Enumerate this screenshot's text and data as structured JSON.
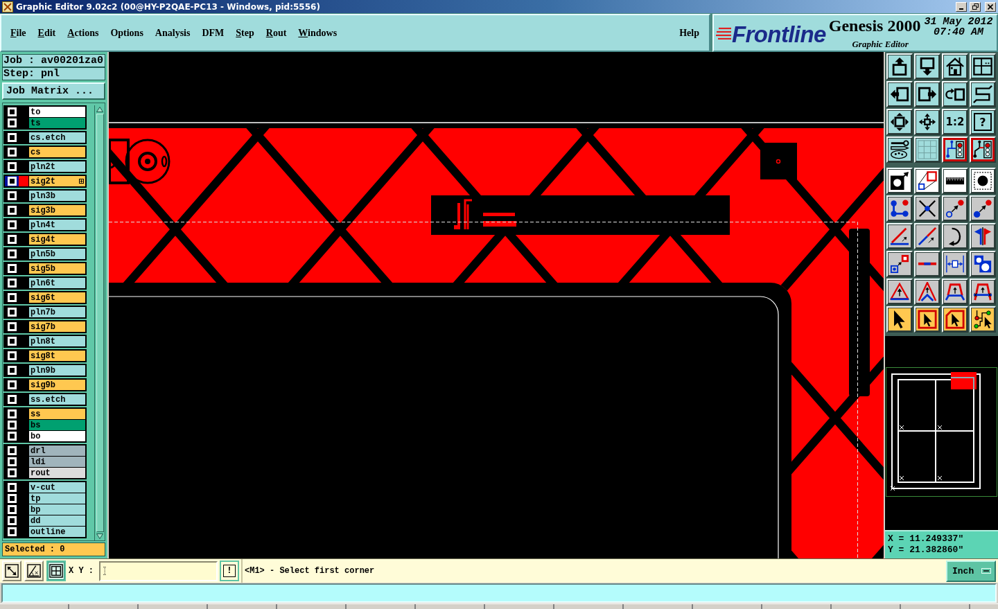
{
  "window": {
    "title": "Graphic Editor 9.02c2 (00@HY-P2QAE-PC13 - Windows, pid:5556)"
  },
  "menu": {
    "items": [
      {
        "label": "File",
        "mnemonic": true
      },
      {
        "label": "Edit",
        "mnemonic": true
      },
      {
        "label": "Actions",
        "mnemonic": true
      },
      {
        "label": "Options",
        "mnemonic": false
      },
      {
        "label": "Analysis",
        "mnemonic": false
      },
      {
        "label": "DFM",
        "mnemonic": false
      },
      {
        "label": "Step",
        "mnemonic": true
      },
      {
        "label": "Rout",
        "mnemonic": true
      },
      {
        "label": "Windows",
        "mnemonic": true
      }
    ],
    "help": {
      "label": "Help",
      "mnemonic": false
    }
  },
  "brand": {
    "logo": "Frontline",
    "product": "Genesis 2000",
    "date": "31 May 2012",
    "time": "07:40 AM",
    "subtitle": "Graphic Editor"
  },
  "job_panel": {
    "job": "Job : av00201za0",
    "step": "Step: pnl",
    "matrix_button": "Job Matrix ...",
    "layer_groups": [
      {
        "layers": [
          {
            "name": "to",
            "kind": "silk",
            "color": "#000000",
            "selected": false
          },
          {
            "name": "ts",
            "kind": "mask",
            "color": "#000000",
            "selected": false
          }
        ]
      },
      {
        "layers": [
          {
            "name": "cs.etch",
            "kind": "document",
            "color": "#000000",
            "selected": false
          }
        ]
      },
      {
        "layers": [
          {
            "name": "cs",
            "kind": "signal",
            "color": "#000000",
            "selected": false
          }
        ]
      },
      {
        "layers": [
          {
            "name": "pln2t",
            "kind": "plane",
            "color": "#000000",
            "selected": false
          }
        ]
      },
      {
        "layers": [
          {
            "name": "sig2t",
            "kind": "signal",
            "color": "#ff0000",
            "selected": true
          }
        ]
      },
      {
        "layers": [
          {
            "name": "pln3b",
            "kind": "plane",
            "color": "#000000",
            "selected": false
          }
        ]
      },
      {
        "layers": [
          {
            "name": "sig3b",
            "kind": "signal",
            "color": "#000000",
            "selected": false
          }
        ]
      },
      {
        "layers": [
          {
            "name": "pln4t",
            "kind": "plane",
            "color": "#000000",
            "selected": false
          }
        ]
      },
      {
        "layers": [
          {
            "name": "sig4t",
            "kind": "signal",
            "color": "#000000",
            "selected": false
          }
        ]
      },
      {
        "layers": [
          {
            "name": "pln5b",
            "kind": "plane",
            "color": "#000000",
            "selected": false
          }
        ]
      },
      {
        "layers": [
          {
            "name": "sig5b",
            "kind": "signal",
            "color": "#000000",
            "selected": false
          }
        ]
      },
      {
        "layers": [
          {
            "name": "pln6t",
            "kind": "plane",
            "color": "#000000",
            "selected": false
          }
        ]
      },
      {
        "layers": [
          {
            "name": "sig6t",
            "kind": "signal",
            "color": "#000000",
            "selected": false
          }
        ]
      },
      {
        "layers": [
          {
            "name": "pln7b",
            "kind": "plane",
            "color": "#000000",
            "selected": false
          }
        ]
      },
      {
        "layers": [
          {
            "name": "sig7b",
            "kind": "signal",
            "color": "#000000",
            "selected": false
          }
        ]
      },
      {
        "layers": [
          {
            "name": "pln8t",
            "kind": "plane",
            "color": "#000000",
            "selected": false
          }
        ]
      },
      {
        "layers": [
          {
            "name": "sig8t",
            "kind": "signal",
            "color": "#000000",
            "selected": false
          }
        ]
      },
      {
        "layers": [
          {
            "name": "pln9b",
            "kind": "plane",
            "color": "#000000",
            "selected": false
          }
        ]
      },
      {
        "layers": [
          {
            "name": "sig9b",
            "kind": "signal",
            "color": "#000000",
            "selected": false
          }
        ]
      },
      {
        "layers": [
          {
            "name": "ss.etch",
            "kind": "document",
            "color": "#000000",
            "selected": false
          }
        ]
      },
      {
        "layers": [
          {
            "name": "ss",
            "kind": "signal",
            "color": "#000000",
            "selected": false
          },
          {
            "name": "bs",
            "kind": "mask",
            "color": "#000000",
            "selected": false
          },
          {
            "name": "bo",
            "kind": "silk",
            "color": "#000000",
            "selected": false
          }
        ]
      },
      {
        "layers": [
          {
            "name": "drl",
            "kind": "drill",
            "color": "#000000",
            "selected": false
          },
          {
            "name": "ldi",
            "kind": "drill",
            "color": "#000000",
            "selected": false
          },
          {
            "name": "rout",
            "kind": "rout",
            "color": "#000000",
            "selected": false
          }
        ]
      },
      {
        "layers": [
          {
            "name": "v-cut",
            "kind": "document",
            "color": "#000000",
            "selected": false
          },
          {
            "name": "tp",
            "kind": "document",
            "color": "#000000",
            "selected": false
          },
          {
            "name": "bp",
            "kind": "document",
            "color": "#000000",
            "selected": false
          },
          {
            "name": "dd",
            "kind": "document",
            "color": "#000000",
            "selected": false
          },
          {
            "name": "outline",
            "kind": "document",
            "color": "#000000",
            "selected": false
          }
        ]
      }
    ],
    "selected_count": "Selected : 0"
  },
  "toolbar": {
    "groups": [
      {
        "rows": [
          {
            "tools": [
              {
                "kind": "pan-up",
                "on": false
              },
              {
                "kind": "pan-down",
                "on": false
              },
              {
                "kind": "home",
                "on": false
              },
              {
                "kind": "window",
                "on": false
              }
            ]
          },
          {
            "tools": [
              {
                "kind": "pan-left",
                "on": false
              },
              {
                "kind": "pan-right",
                "on": false
              },
              {
                "kind": "undo-view",
                "on": false
              },
              {
                "kind": "route",
                "on": false
              }
            ]
          },
          {
            "tools": [
              {
                "kind": "zoom-out",
                "on": false
              },
              {
                "kind": "zoom-in",
                "on": false
              },
              {
                "kind": "text",
                "label": "1:2",
                "on": false
              },
              {
                "kind": "framed-text",
                "label": "?",
                "on": false
              }
            ]
          },
          {
            "tools": [
              {
                "kind": "tools",
                "on": false
              },
              {
                "kind": "grid",
                "on": false
              },
              {
                "kind": "snap-a",
                "on": true
              },
              {
                "kind": "snap-b",
                "on": true
              }
            ]
          }
        ]
      },
      {
        "rows": [
          {
            "tools": [
              {
                "kind": "snap-center",
                "on": false
              },
              {
                "kind": "snap-box",
                "on": false
              },
              {
                "kind": "measure",
                "on": false
              },
              {
                "kind": "snap-pad",
                "on": false
              }
            ]
          },
          {
            "tools": [
              {
                "kind": "connect",
                "on": false
              },
              {
                "kind": "delete",
                "on": false
              },
              {
                "kind": "move-hollow",
                "on": false
              },
              {
                "kind": "move-solid",
                "on": false
              }
            ]
          },
          {
            "tools": [
              {
                "kind": "angle",
                "on": false
              },
              {
                "kind": "line",
                "on": false
              },
              {
                "kind": "rotate",
                "on": false
              },
              {
                "kind": "mirror",
                "on": false
              }
            ]
          },
          {
            "tools": [
              {
                "kind": "move-pad",
                "on": false
              },
              {
                "kind": "cut-line",
                "on": false
              },
              {
                "kind": "dimension",
                "on": false
              },
              {
                "kind": "shapes",
                "on": false
              }
            ]
          },
          {
            "tools": [
              {
                "kind": "triangle",
                "on": false
              },
              {
                "kind": "chevron",
                "on": false
              },
              {
                "kind": "arch",
                "on": false
              },
              {
                "kind": "arch-cross",
                "on": false
              }
            ]
          },
          {
            "tools": [
              {
                "kind": "pointer",
                "on": false
              },
              {
                "kind": "pointer-box",
                "on": false
              },
              {
                "kind": "pointer-poly",
                "on": false
              },
              {
                "kind": "pointer-net",
                "on": false
              }
            ]
          }
        ]
      }
    ]
  },
  "coordinates": {
    "x": "X = 11.249337\"",
    "y": "Y = 21.382860\""
  },
  "command_bar": {
    "tools": [
      {
        "kind": "diagonal",
        "selected": false
      },
      {
        "kind": "angle",
        "selected": false
      },
      {
        "kind": "grid",
        "selected": true
      }
    ],
    "xy_label": "X Y :",
    "alert_button": "!",
    "message": "<M1> - Select first corner",
    "units": "Inch"
  }
}
